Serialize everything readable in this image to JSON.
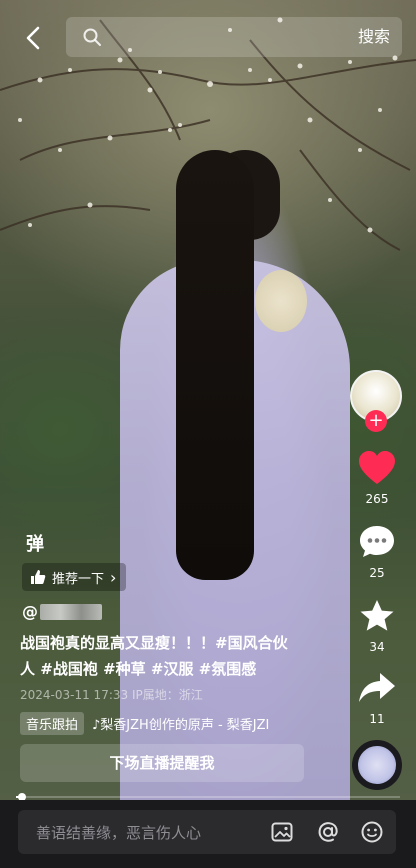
{
  "topbar": {
    "search_label": "搜索"
  },
  "actions": {
    "likes": "265",
    "comments": "25",
    "favorites": "34",
    "shares": "11",
    "follow_symbol": "+"
  },
  "overlay": {
    "danmu_label": "弹",
    "recommend_label": "推荐一下",
    "recommend_arrow": "›"
  },
  "post": {
    "author_prefix": "@",
    "caption_line1": "战国袍真的显高又显瘦！！！",
    "caption_tags_line1": "#国风合伙",
    "caption_line2_tag_cont": "人",
    "caption_tags": [
      "#战国袍",
      "#种草",
      "#汉服",
      "#氛围感"
    ],
    "meta": "2024-03-11 17:33  IP属地：浙江",
    "music_tag": "音乐跟拍",
    "music_text": "♪梨香JZH创作的原声 - 梨香JZI"
  },
  "live": {
    "button_label": "下场直播提醒我"
  },
  "playback": {
    "progress": 0.01
  },
  "comment": {
    "placeholder": "善语结善缘，恶言伤人心"
  },
  "colors": {
    "like": "#fe2c55",
    "follow": "#fe2c55"
  }
}
